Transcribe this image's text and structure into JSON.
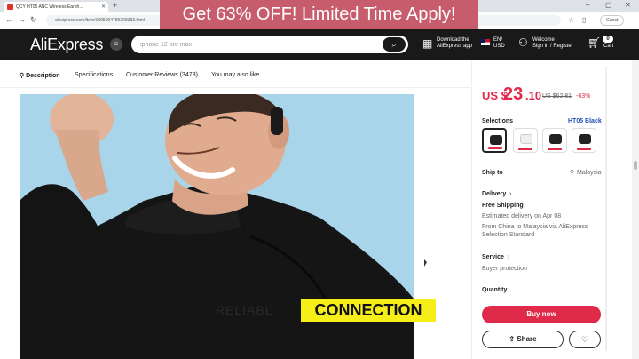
{
  "browser": {
    "tab_title": "QCY HT05 ANC Wireless Earph...",
    "url": "aliexpress.com/item/1005004786268333.html",
    "guest_label": "Guest"
  },
  "promo_banner": "Get 63% OFF! Limited Time Apply!",
  "header": {
    "logo": "AliExpress",
    "search_placeholder": "iphone 12 pro max",
    "download_line1": "Download the",
    "download_line2": "AliExpress app",
    "locale_line1": "EN/",
    "locale_line2": "USD",
    "welcome_line1": "Welcome",
    "welcome_line2": "Sign in / Register",
    "cart_count": "0",
    "cart_label": "Cart"
  },
  "product_tabs": [
    {
      "label": "Description"
    },
    {
      "label": "Specifications"
    },
    {
      "label": "Customer Reviews (3473)"
    },
    {
      "label": "You may also like"
    }
  ],
  "image_caption": {
    "faded": "RELIABL",
    "highlight": "CONNECTION"
  },
  "panel": {
    "currency": "US $",
    "price_whole": "23",
    "price_decimal": ".10",
    "price_old": "US $62.81",
    "discount": "-63%",
    "selections_label": "Selections",
    "selection_value": "HT05 Black",
    "ship_to_label": "Ship to",
    "ship_to_value": "Malaysia",
    "delivery_label": "Delivery",
    "free_shipping": "Free Shipping",
    "estimated_delivery": "Estimated delivery on Apr 08",
    "from_text": "From China to Malaysia via AliExpress",
    "from_text2": "Selection Standard",
    "service_label": "Service",
    "service_value": "Buyer protection",
    "quantity_label": "Quantity",
    "buy_now": "Buy now",
    "share": "Share"
  },
  "colors": {
    "brand_red": "#e02a4a",
    "header_bg": "#191919",
    "promo_bg": "#c75c6c",
    "highlight_yellow": "#f6ee19"
  }
}
